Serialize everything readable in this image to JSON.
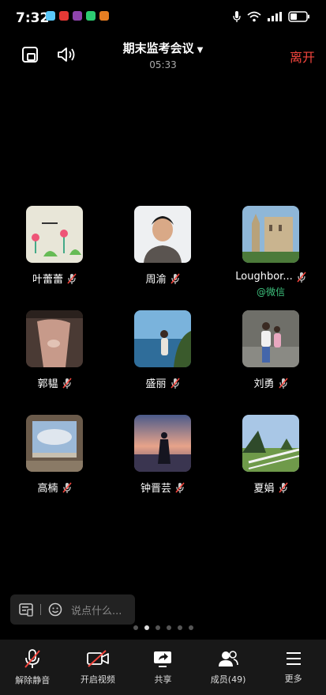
{
  "status": {
    "time": "7:32"
  },
  "header": {
    "title": "期末监考会议",
    "duration": "05:33",
    "leave_label": "离开"
  },
  "participants": [
    {
      "name": "叶蕾蕾"
    },
    {
      "name": "周渝"
    },
    {
      "name": "Loughbor...",
      "sub": "@微信"
    },
    {
      "name": "郭韫"
    },
    {
      "name": "盛丽"
    },
    {
      "name": "刘勇"
    },
    {
      "name": "高楠"
    },
    {
      "name": "钟晋芸"
    },
    {
      "name": "夏娟"
    }
  ],
  "chat": {
    "placeholder": "说点什么..."
  },
  "pager": {
    "count": 6,
    "active": 2
  },
  "toolbar": {
    "unmute": "解除静音",
    "video": "开启视频",
    "share": "共享",
    "members": "成员(49)",
    "more": "更多"
  },
  "colors": {
    "accent_red": "#f2453d",
    "wechat_green": "#3dc07c"
  }
}
